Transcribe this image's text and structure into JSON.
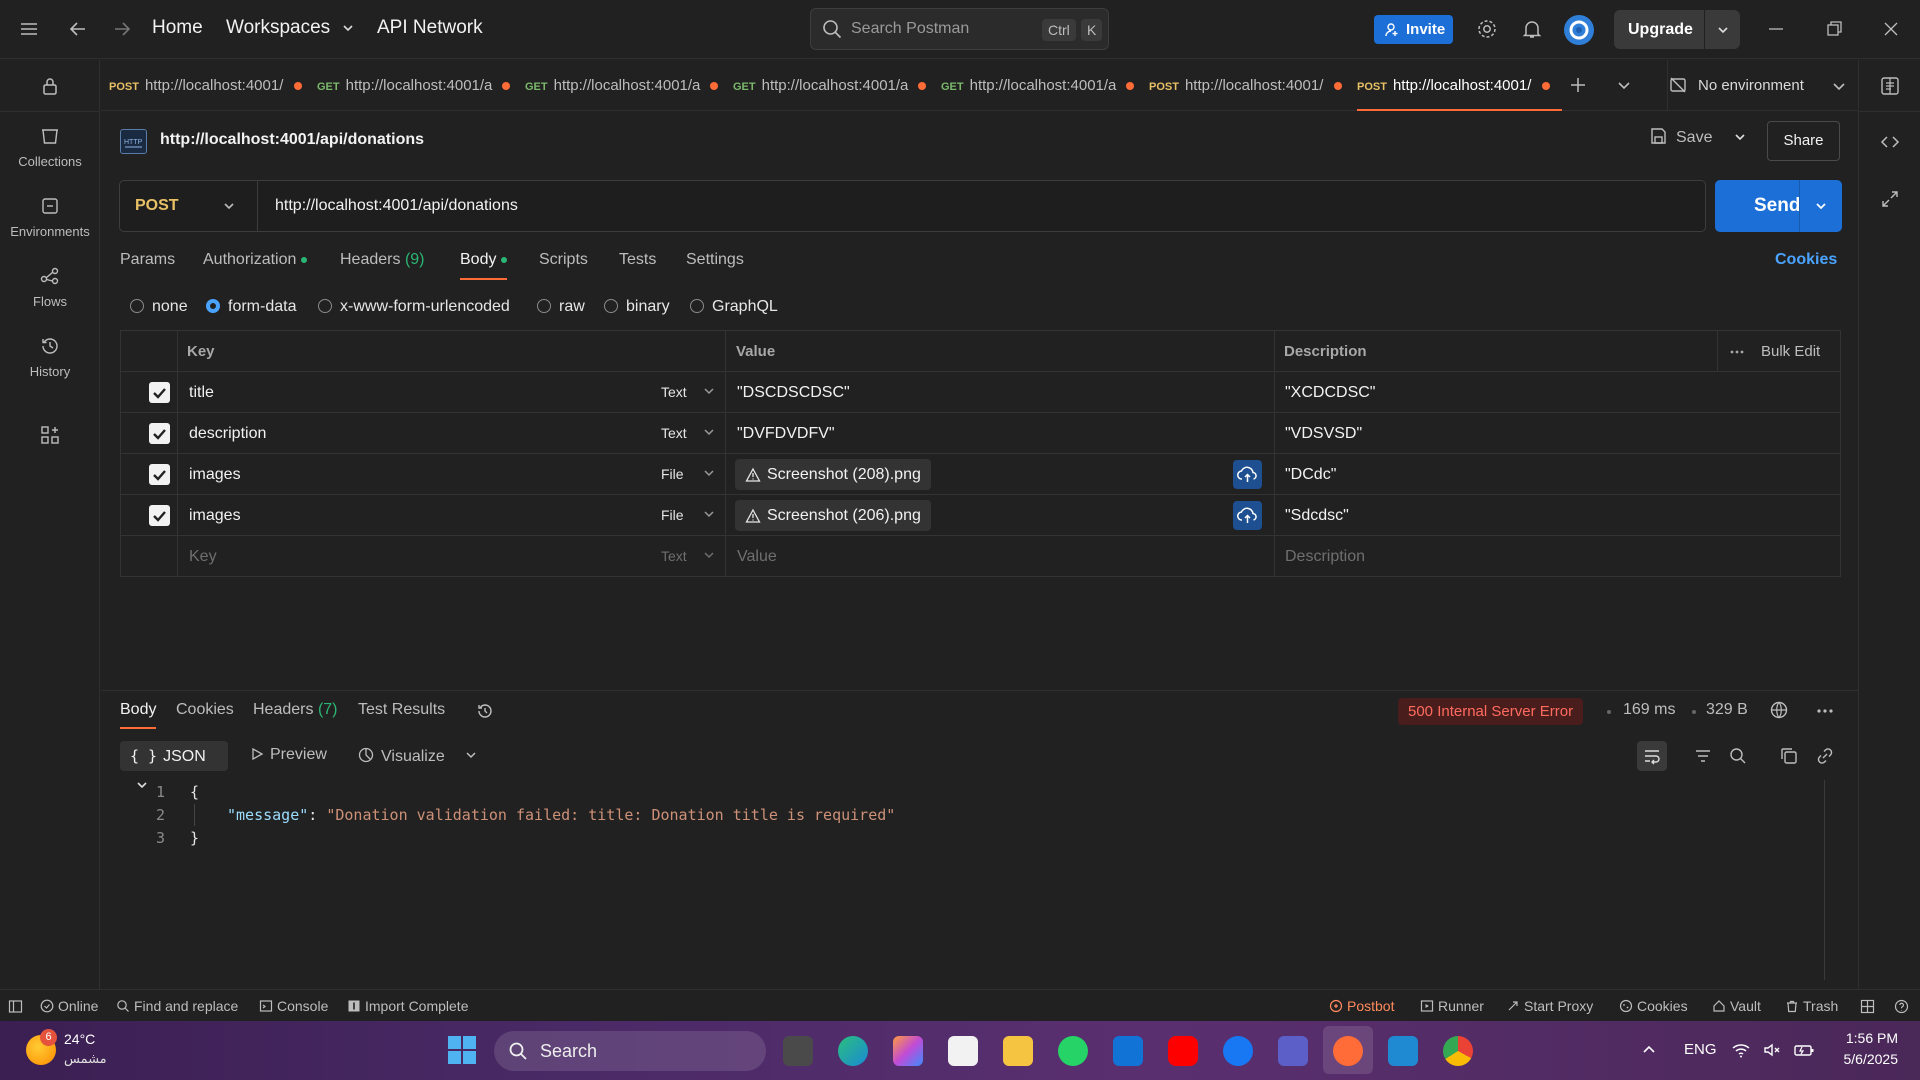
{
  "titlebar": {
    "nav": {
      "home": "Home",
      "workspaces": "Workspaces",
      "api_network": "API Network"
    },
    "search_placeholder": "Search Postman",
    "search_kbd_ctrl": "Ctrl",
    "search_kbd_k": "K",
    "invite": "Invite",
    "upgrade": "Upgrade"
  },
  "leftrail": {
    "items": [
      {
        "label": "Collections",
        "icon": "collections-icon"
      },
      {
        "label": "Environments",
        "icon": "environments-icon"
      },
      {
        "label": "Flows",
        "icon": "flows-icon"
      },
      {
        "label": "History",
        "icon": "history-icon"
      }
    ]
  },
  "tabs": [
    {
      "method": "POST",
      "url": "http://localhost:4001/"
    },
    {
      "method": "GET",
      "url": "http://localhost:4001/a"
    },
    {
      "method": "GET",
      "url": "http://localhost:4001/a"
    },
    {
      "method": "GET",
      "url": "http://localhost:4001/a"
    },
    {
      "method": "GET",
      "url": "http://localhost:4001/a"
    },
    {
      "method": "POST",
      "url": "http://localhost:4001/"
    },
    {
      "method": "POST",
      "url": "http://localhost:4001/",
      "active": true
    }
  ],
  "environment": "No environment",
  "request": {
    "title": "http://localhost:4001/api/donations",
    "save": "Save",
    "share": "Share",
    "method": "POST",
    "url": "http://localhost:4001/api/donations",
    "send": "Send",
    "tabs": {
      "params": "Params",
      "authorization": "Authorization",
      "headers": "Headers",
      "headers_count": "(9)",
      "body": "Body",
      "scripts": "Scripts",
      "tests": "Tests",
      "settings": "Settings"
    },
    "cookies": "Cookies",
    "body_types": [
      "none",
      "form-data",
      "x-www-form-urlencoded",
      "raw",
      "binary",
      "GraphQL"
    ],
    "body_type_selected": "form-data"
  },
  "form_table": {
    "headers": {
      "key": "Key",
      "value": "Value",
      "description": "Description",
      "bulk_edit": "Bulk Edit"
    },
    "rows": [
      {
        "key": "title",
        "type": "Text",
        "value": "\"DSCDSCDSC\"",
        "description": "\"XCDCDSC\""
      },
      {
        "key": "description",
        "type": "Text",
        "value": "\"DVFDVDFV\"",
        "description": "\"VDSVSD\""
      },
      {
        "key": "images",
        "type": "File",
        "value": "Screenshot (208).png",
        "description": "\"DCdc\""
      },
      {
        "key": "images",
        "type": "File",
        "value": "Screenshot (206).png",
        "description": "\"Sdcdsc\""
      }
    ],
    "placeholder": {
      "key": "Key",
      "type": "Text",
      "value": "Value",
      "description": "Description"
    }
  },
  "response": {
    "tabs": {
      "body": "Body",
      "cookies": "Cookies",
      "headers": "Headers",
      "headers_count": "(7)",
      "test_results": "Test Results"
    },
    "status": "500 Internal Server Error",
    "time": "169 ms",
    "size": "329 B",
    "format": "JSON",
    "preview": "Preview",
    "visualize": "Visualize",
    "code_lines": [
      "1",
      "2",
      "3"
    ],
    "json_open": "{",
    "json_key": "\"message\"",
    "json_colon": ": ",
    "json_value": "\"Donation validation failed: title: Donation title is required\"",
    "json_close": "}"
  },
  "statusbar": {
    "online": "Online",
    "find_replace": "Find and replace",
    "console": "Console",
    "import": "Import Complete",
    "postbot": "Postbot",
    "runner": "Runner",
    "start_proxy": "Start Proxy",
    "cookies": "Cookies",
    "vault": "Vault",
    "trash": "Trash"
  },
  "taskbar": {
    "weather_temp": "24°C",
    "weather_desc": "مشمس",
    "weather_badge": "6",
    "search": "Search",
    "lang": "ENG",
    "time": "1:56 PM",
    "date": "5/6/2025"
  },
  "colors": {
    "accent_orange": "#ff6c37",
    "send_blue": "#1c6fd6",
    "error_red": "#ff6b5e",
    "post_yellow": "#e8c166",
    "get_green": "#7ab86a"
  }
}
